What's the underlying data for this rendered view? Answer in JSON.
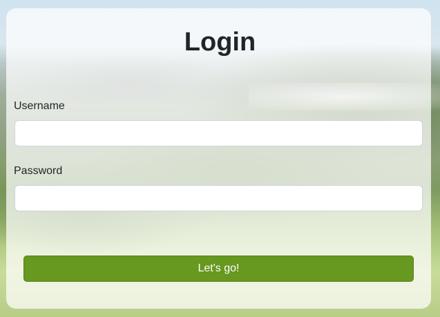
{
  "login": {
    "title": "Login",
    "username": {
      "label": "Username",
      "value": "",
      "placeholder": ""
    },
    "password": {
      "label": "Password",
      "value": "",
      "placeholder": ""
    },
    "submit_label": "Let's go!"
  },
  "colors": {
    "button": "#67981f",
    "card": "rgba(255,255,255,0.72)",
    "text": "#212529"
  }
}
